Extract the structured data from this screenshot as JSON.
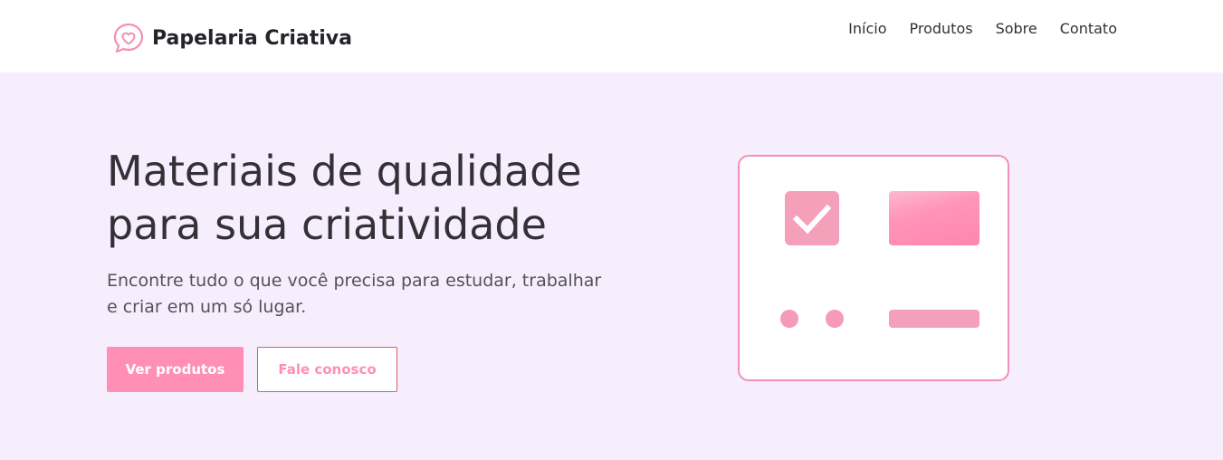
{
  "header": {
    "brand_name": "Papelaria Criativa",
    "brand_icon": "heart-chat-bubble-icon",
    "nav": [
      {
        "label": "Início"
      },
      {
        "label": "Produtos"
      },
      {
        "label": "Sobre"
      },
      {
        "label": "Contato"
      }
    ]
  },
  "hero": {
    "title": "Materiais de qualidade para sua criatividade",
    "subtitle": "Encontre tudo o que você precisa para estudar, trabalhar e criar em um só lugar.",
    "primary_button": "Ver produtos",
    "secondary_button": "Fale conosco",
    "illustration_icons": [
      "checkbox-icon",
      "card-shape",
      "dot-shape",
      "bar-shape"
    ]
  },
  "colors": {
    "accent": "#ff8fb4",
    "hero_background": "#f6eefd",
    "text": "#333036",
    "secondary_border": "#e05a66"
  }
}
